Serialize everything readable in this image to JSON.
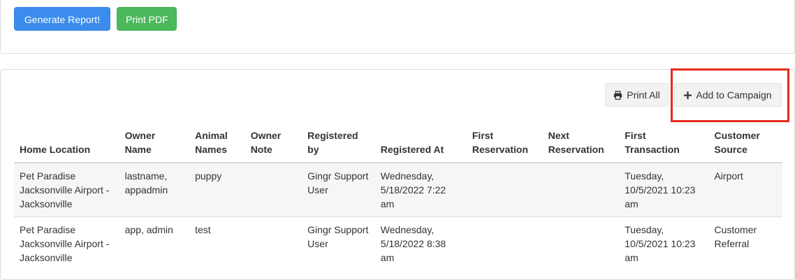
{
  "toolbar": {
    "generate_label": "Generate Report!",
    "print_pdf_label": "Print PDF"
  },
  "actions": {
    "print_all_label": "Print All",
    "add_campaign_label": "Add to Campaign",
    "print_icon": "printer-icon",
    "add_icon": "plus-icon"
  },
  "colors": {
    "primary": "#3b8ced",
    "success": "#4cb85c",
    "highlight": "#e8291c"
  },
  "table": {
    "headers": [
      "Home Location",
      "Owner Name",
      "Animal Names",
      "Owner Note",
      "Registered by",
      "Registered At",
      "First Reservation",
      "Next Reservation",
      "First Transaction",
      "Customer Source"
    ],
    "rows": [
      [
        "Pet Paradise Jacksonville Airport - Jacksonville",
        "lastname, appadmin",
        "puppy",
        "",
        "Gingr Support User",
        "Wednesday, 5/18/2022 7:22 am",
        "",
        "",
        "Tuesday, 10/5/2021 10:23 am",
        "Airport"
      ],
      [
        "Pet Paradise Jacksonville Airport - Jacksonville",
        "app, admin",
        "test",
        "",
        "Gingr Support User",
        "Wednesday, 5/18/2022 8:38 am",
        "",
        "",
        "Tuesday, 10/5/2021 10:23 am",
        "Customer Referral"
      ]
    ]
  }
}
